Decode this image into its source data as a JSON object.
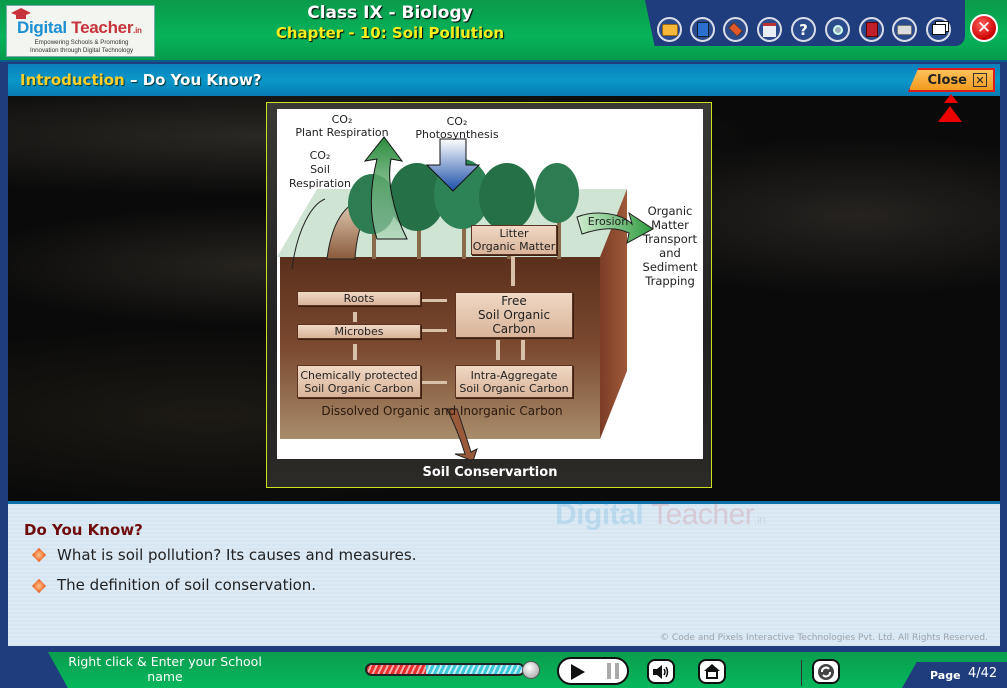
{
  "header": {
    "logo": {
      "brand_digital": "Digital",
      "brand_teacher": "Teacher",
      "brand_suffix": ".in",
      "tagline_line1": "Empowering Schools & Promoting",
      "tagline_line2": "Innovation through Digital Technology"
    },
    "class_title": "Class IX - Biology",
    "chapter_title": "Chapter - 10: Soil Pollution",
    "toolbar_icons": [
      {
        "name": "folder-clock-icon",
        "glyph": "◔"
      },
      {
        "name": "notebook-icon",
        "glyph": "▮"
      },
      {
        "name": "drawing-board-icon",
        "glyph": "◆"
      },
      {
        "name": "notes-icon",
        "glyph": "▤"
      },
      {
        "name": "help-icon",
        "glyph": "?"
      },
      {
        "name": "zoom-search-icon",
        "glyph": "⚲"
      },
      {
        "name": "book-icon",
        "glyph": "▮"
      },
      {
        "name": "open-book-icon",
        "glyph": "❐"
      },
      {
        "name": "window-resize-icon",
        "glyph": "⧉"
      }
    ],
    "exit_glyph": "✕"
  },
  "section": {
    "title_highlight": "Introduction",
    "title_rest": " – Do You Know?",
    "close_label": "Close",
    "close_glyph": "✕"
  },
  "figure": {
    "caption": "Soil Conservartion",
    "labels": {
      "co2_plant": "CO₂",
      "plant_respiration": "Plant Respiration",
      "co2_photo": "CO₂",
      "photosynthesis": "Photosynthesis",
      "co2_soil": "CO₂",
      "soil": "Soil",
      "respiration": "Respiration",
      "erosion": "Erosion",
      "litter_line1": "Litter",
      "litter_line2": "Organic Matter",
      "transport": [
        "Organic",
        "Matter",
        "Transport",
        "and",
        "Sediment",
        "Trapping"
      ],
      "roots": "Roots",
      "microbes": "Microbes",
      "free_line1": "Free",
      "free_line2": "Soil Organic Carbon",
      "chem_line1": "Chemically protected",
      "chem_line2": "Soil Organic Carbon",
      "intra_line1": "Intra-Aggregate",
      "intra_line2": "Soil Organic Carbon",
      "dissolved": "Dissolved Organic and Inorganic Carbon"
    }
  },
  "info": {
    "heading": "Do You Know?",
    "bullets": [
      "What is soil pollution? Its causes and measures.",
      "The definition of soil conservation."
    ],
    "watermark_digital": "Digital",
    "watermark_teacher": "Teacher",
    "watermark_suffix": ".in",
    "copyright": "© Code and Pixels Interactive Technologies  Pvt. Ltd. All Rights Reserved."
  },
  "footer": {
    "school_prompt": "Right click & Enter your School name",
    "progress_fraction": 0.38,
    "page_label": "Page",
    "page_value": "4/42",
    "colors": {
      "progress_played": "#e83030",
      "progress_rest": "#3fc8d8"
    }
  }
}
